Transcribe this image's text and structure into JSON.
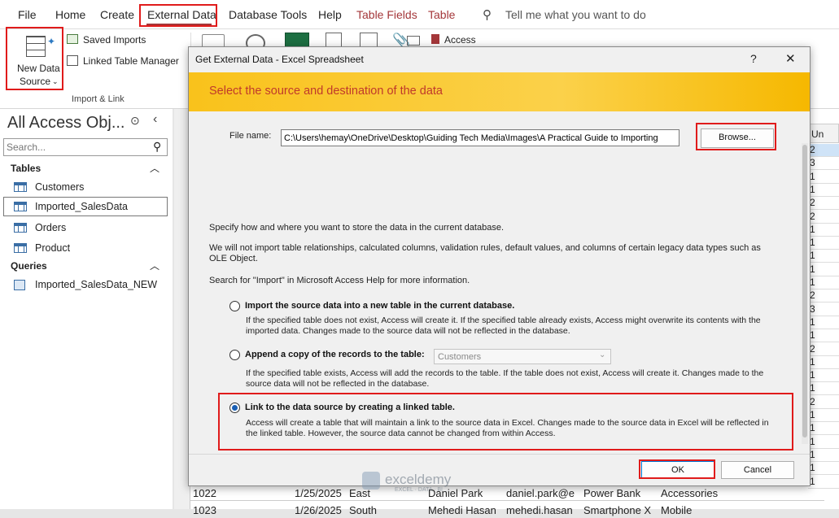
{
  "menu": {
    "items": [
      "File",
      "Home",
      "Create",
      "External Data",
      "Database Tools",
      "Help"
    ],
    "context_tabs": [
      "Table Fields",
      "Table"
    ],
    "tell_me": "Tell me what you want to do"
  },
  "ribbon": {
    "new_data_source_line1": "New Data",
    "new_data_source_line2": "Source",
    "saved_imports": "Saved Imports",
    "linked_table_manager": "Linked Table Manager",
    "group_label": "Import & Link",
    "access_label": "Access"
  },
  "nav": {
    "title": "All Access Obj...",
    "search_placeholder": "Search...",
    "tables_header": "Tables",
    "tables": [
      "Customers",
      "Imported_SalesData",
      "Orders",
      "Product"
    ],
    "queries_header": "Queries",
    "queries": [
      "Imported_SalesData_NEW"
    ]
  },
  "grid": {
    "header_last": "Un",
    "right_column": [
      "2",
      "3",
      "1",
      "1",
      "2",
      "2",
      "1",
      "1",
      "1",
      "1",
      "1",
      "2",
      "3",
      "1",
      "1",
      "2",
      "1",
      "1",
      "1",
      "2",
      "1",
      "1",
      "1",
      "1",
      "1",
      "1"
    ],
    "rows": [
      {
        "id": "1022",
        "date": "1/25/2025",
        "region": "East",
        "name": "Daniel Park",
        "email": "daniel.park@e",
        "product": "Power Bank",
        "category": "Accessories",
        "qty": "1"
      },
      {
        "id": "1023",
        "date": "1/26/2025",
        "region": "South",
        "name": "Mehedi Hasan",
        "email": "mehedi.hasan",
        "product": "Smartphone X",
        "category": "Mobile",
        "qty": "1"
      }
    ]
  },
  "dialog": {
    "title": "Get External Data - Excel Spreadsheet",
    "help": "?",
    "close": "✕",
    "banner": "Select the source and destination of the data",
    "file_label": "File name:",
    "file_value": "C:\\Users\\hemay\\OneDrive\\Desktop\\Guiding Tech Media\\Images\\A Practical Guide to Importing",
    "browse": "Browse...",
    "specify": "Specify how and where you want to store the data in the current database.",
    "note": "We will not import table relationships, calculated columns, validation rules, default values, and columns of certain legacy data types such as OLE Object.",
    "help_text": "Search for \"Import\" in Microsoft Access Help for more information.",
    "options": [
      {
        "title": "Import the source data into a new table in the current database.",
        "desc": "If the specified table does not exist, Access will create it. If the specified table already exists, Access might overwrite its contents with the imported data. Changes made to the source data will not be reflected in the database.",
        "selected": false
      },
      {
        "title": "Append a copy of the records to the table:",
        "desc": "If the specified table exists, Access will add the records to the table. If the table does not exist, Access will create it. Changes made to the source data will not be reflected in the database.",
        "selected": false
      },
      {
        "title": "Link to the data source by creating a linked table.",
        "desc": "Access will create a table that will maintain a link to the source data in Excel. Changes made to the source data in Excel will be reflected in the linked table. However, the source data cannot be changed from within Access.",
        "selected": true
      }
    ],
    "append_select": "Customers",
    "ok": "OK",
    "cancel": "Cancel"
  },
  "watermark": {
    "name": "exceldemy",
    "tag": "EXCEL · DATA · BI"
  }
}
